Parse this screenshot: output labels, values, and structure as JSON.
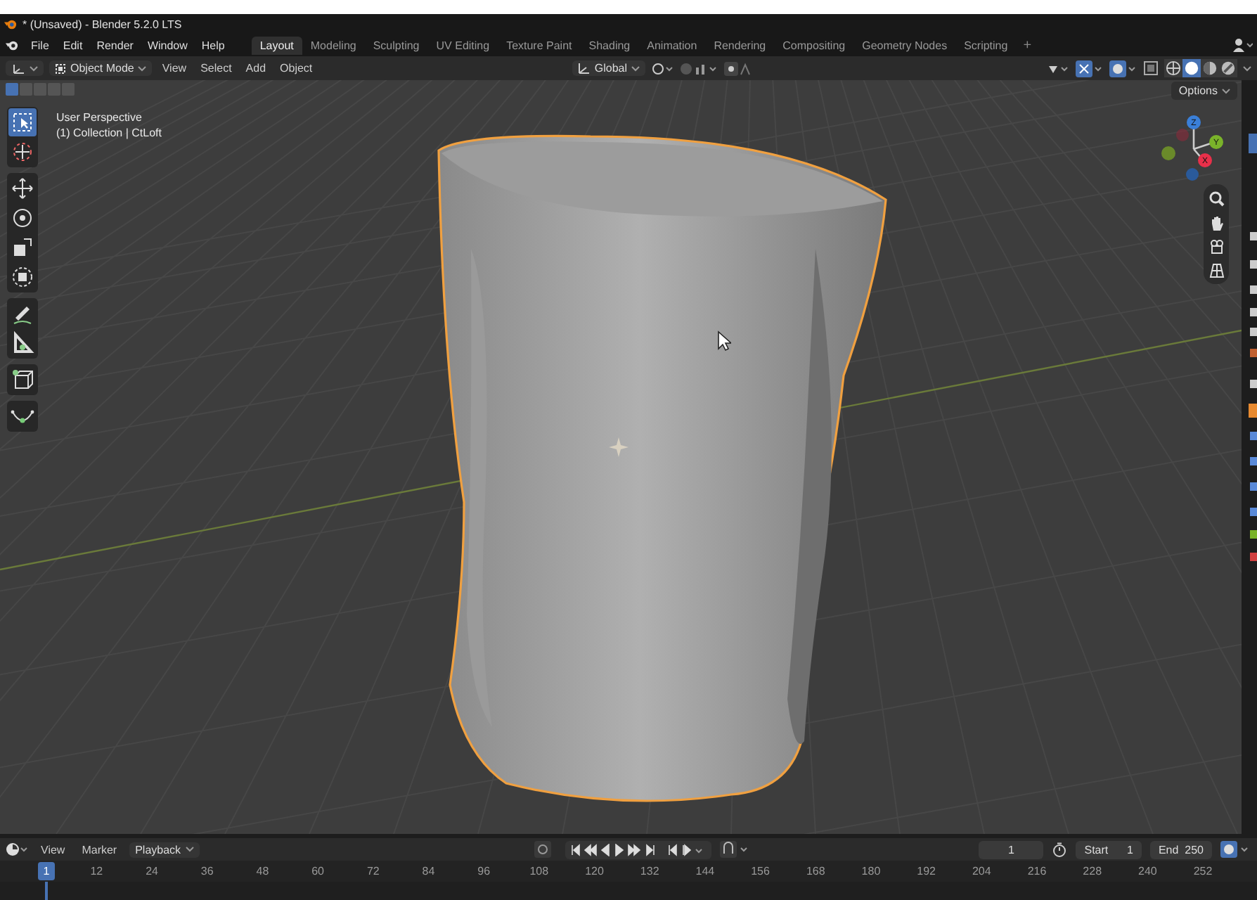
{
  "title_bar": {
    "title": "* (Unsaved) - Blender 5.2.0 LTS"
  },
  "menu": [
    "File",
    "Edit",
    "Render",
    "Window",
    "Help"
  ],
  "workspaces": [
    {
      "label": "Layout",
      "selected": true
    },
    {
      "label": "Modeling",
      "selected": false
    },
    {
      "label": "Sculpting",
      "selected": false
    },
    {
      "label": "UV Editing",
      "selected": false
    },
    {
      "label": "Texture Paint",
      "selected": false
    },
    {
      "label": "Shading",
      "selected": false
    },
    {
      "label": "Animation",
      "selected": false
    },
    {
      "label": "Rendering",
      "selected": false
    },
    {
      "label": "Compositing",
      "selected": false
    },
    {
      "label": "Geometry Nodes",
      "selected": false
    },
    {
      "label": "Scripting",
      "selected": false
    }
  ],
  "add_workspace": "+",
  "header": {
    "mode": "Object Mode",
    "menus": [
      "View",
      "Select",
      "Add",
      "Object"
    ],
    "orientation": "Global"
  },
  "shading": [
    {
      "kind": "wireframe",
      "selected": false
    },
    {
      "kind": "solid",
      "selected": true
    },
    {
      "kind": "material",
      "selected": false
    },
    {
      "kind": "rendered",
      "selected": false
    }
  ],
  "select_modes": [
    {
      "selected": true
    },
    {
      "selected": false
    },
    {
      "selected": false
    },
    {
      "selected": false
    },
    {
      "selected": false
    }
  ],
  "options": "Options",
  "viewport": {
    "perspective": "User Perspective",
    "object": "(1) Collection | CtLoft",
    "axes": [
      "Z",
      "Y",
      "X"
    ]
  },
  "tool_groups": [
    [
      {
        "kind": "select",
        "selected": true
      },
      {
        "kind": "cursor",
        "selected": false
      }
    ],
    [
      {
        "kind": "move",
        "selected": false
      },
      {
        "kind": "rotate",
        "selected": false
      },
      {
        "kind": "scale",
        "selected": false
      },
      {
        "kind": "transform",
        "selected": false
      }
    ],
    [
      {
        "kind": "annotate",
        "selected": false
      },
      {
        "kind": "measure",
        "selected": false
      }
    ],
    [
      {
        "kind": "add_cube",
        "selected": false
      }
    ],
    [
      {
        "kind": "curve",
        "selected": false
      }
    ]
  ],
  "timeline": {
    "menus": [
      "View",
      "Marker",
      "Playback"
    ],
    "current_frame": "1",
    "start_label": "Start",
    "start": "1",
    "end_label": "End",
    "end": "250",
    "playhead": "1",
    "ticks": [
      "12",
      "24",
      "36",
      "48",
      "60",
      "72",
      "84",
      "96",
      "108",
      "120",
      "132",
      "144",
      "156",
      "168",
      "180",
      "192",
      "204",
      "216",
      "228",
      "240",
      "252"
    ]
  }
}
